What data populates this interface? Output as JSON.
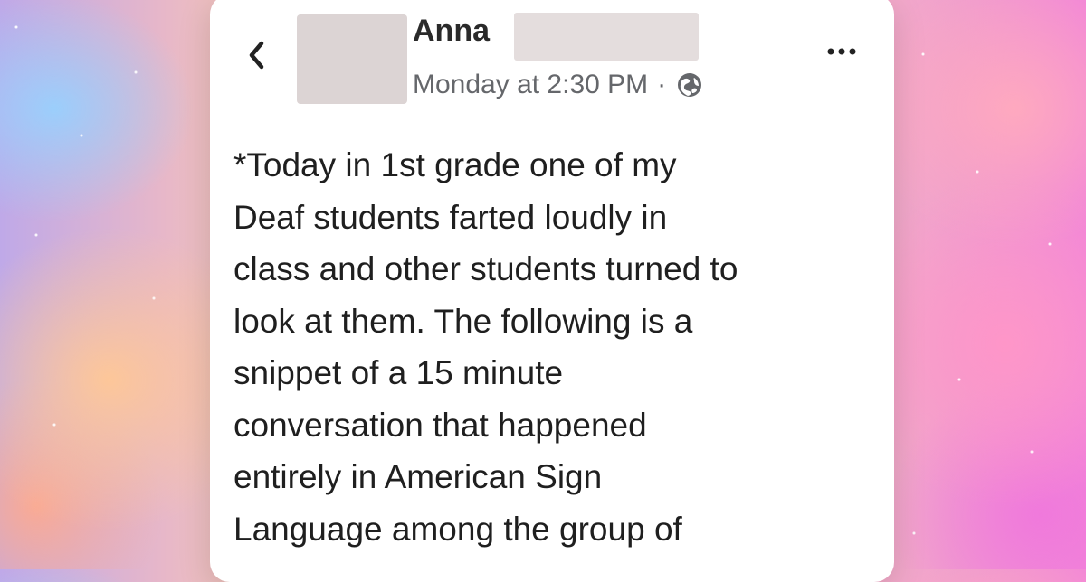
{
  "header": {
    "author_name": "Anna",
    "timestamp": "Monday at 2:30 PM",
    "meta_separator": "·"
  },
  "icons": {
    "back": "chevron-left-icon",
    "avatar": "avatar",
    "privacy": "globe-icon",
    "more": "more-options-icon"
  },
  "colors": {
    "card": "#ffffff",
    "text_primary": "#1f1f1f",
    "text_secondary": "#65676b",
    "redaction": "#dcd4d4"
  },
  "post": {
    "lines": [
      "*Today in 1st grade one of my",
      "Deaf students farted loudly in",
      "class and other students turned to",
      "look at them. The following is a",
      "snippet of a 15 minute",
      "conversation that happened",
      "entirely in American Sign",
      "Language among the group of"
    ]
  }
}
